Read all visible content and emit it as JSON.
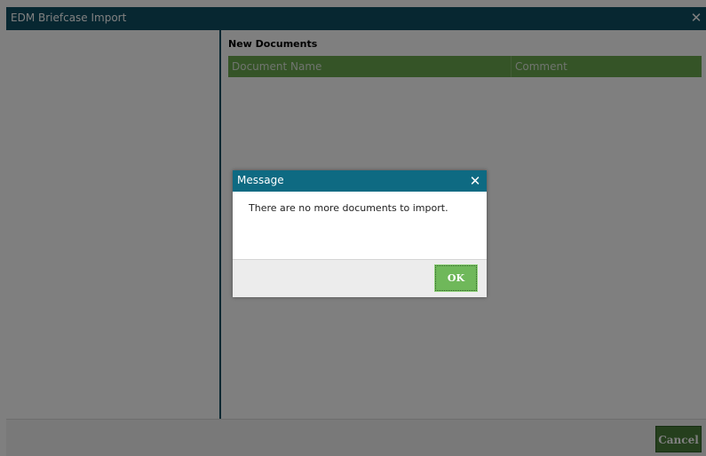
{
  "window": {
    "title": "EDM Briefcase Import",
    "close_glyph": "✕"
  },
  "right_panel": {
    "section_title": "New Documents",
    "columns": [
      "Document Name",
      "Comment"
    ]
  },
  "footer": {
    "cancel_label": "Cancel"
  },
  "dialog": {
    "title": "Message",
    "close_glyph": "✕",
    "message": "There are no more documents to import.",
    "ok_label": "OK"
  },
  "colors": {
    "titlebar": "#0e4f63",
    "dialog_titlebar": "#0e6a82",
    "grid_header": "#6aa84f",
    "ok_button": "#6fb85a",
    "cancel_button": "#4a7f3a"
  }
}
